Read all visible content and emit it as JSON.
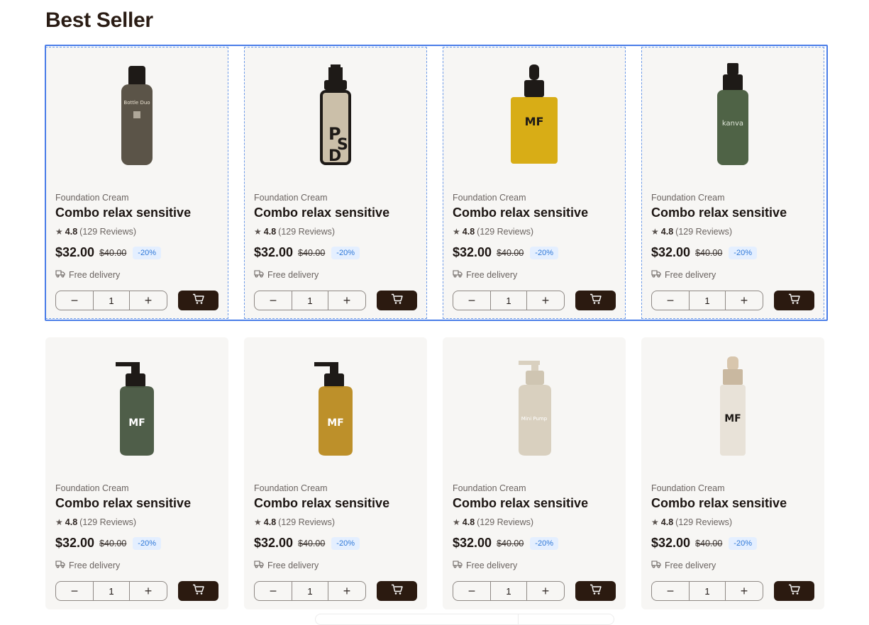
{
  "section": {
    "title": "Best Seller"
  },
  "products": [
    {
      "category": "Foundation Cream",
      "name": "Combo relax sensitive",
      "rating": "4.8",
      "reviews": "(129 Reviews)",
      "price": "$32.00",
      "old_price": "$40.00",
      "discount": "-20%",
      "delivery": "Free delivery",
      "quantity": "1",
      "image": {
        "shape": "bottle-tall",
        "color": "#5b5448",
        "label": "Bottle Duo"
      }
    },
    {
      "category": "Foundation Cream",
      "name": "Combo relax sensitive",
      "rating": "4.8",
      "reviews": "(129 Reviews)",
      "price": "$32.00",
      "old_price": "$40.00",
      "discount": "-20%",
      "delivery": "Free delivery",
      "quantity": "1",
      "image": {
        "shape": "pump-bottle",
        "color": "#cbbfa9",
        "label": "PSD"
      }
    },
    {
      "category": "Foundation Cream",
      "name": "Combo relax sensitive",
      "rating": "4.8",
      "reviews": "(129 Reviews)",
      "price": "$32.00",
      "old_price": "$40.00",
      "discount": "-20%",
      "delivery": "Free delivery",
      "quantity": "1",
      "image": {
        "shape": "dropper-square",
        "color": "#d8ad16",
        "label": "MF"
      }
    },
    {
      "category": "Foundation Cream",
      "name": "Combo relax sensitive",
      "rating": "4.8",
      "reviews": "(129 Reviews)",
      "price": "$32.00",
      "old_price": "$40.00",
      "discount": "-20%",
      "delivery": "Free delivery",
      "quantity": "1",
      "image": {
        "shape": "spray-bottle",
        "color": "#4f6346",
        "label": "kanva"
      }
    },
    {
      "category": "Foundation Cream",
      "name": "Combo relax sensitive",
      "rating": "4.8",
      "reviews": "(129 Reviews)",
      "price": "$32.00",
      "old_price": "$40.00",
      "discount": "-20%",
      "delivery": "Free delivery",
      "quantity": "1",
      "image": {
        "shape": "pump-round",
        "color": "#46553f",
        "label": "MF"
      }
    },
    {
      "category": "Foundation Cream",
      "name": "Combo relax sensitive",
      "rating": "4.8",
      "reviews": "(129 Reviews)",
      "price": "$32.00",
      "old_price": "$40.00",
      "discount": "-20%",
      "delivery": "Free delivery",
      "quantity": "1",
      "image": {
        "shape": "pump-round",
        "color": "#b98a1f",
        "label": "MF"
      }
    },
    {
      "category": "Foundation Cream",
      "name": "Combo relax sensitive",
      "rating": "4.8",
      "reviews": "(129 Reviews)",
      "price": "$32.00",
      "old_price": "$40.00",
      "discount": "-20%",
      "delivery": "Free delivery",
      "quantity": "1",
      "image": {
        "shape": "pump-soft",
        "color": "#d9d0bf",
        "label": "Mini Pump"
      }
    },
    {
      "category": "Foundation Cream",
      "name": "Combo relax sensitive",
      "rating": "4.8",
      "reviews": "(129 Reviews)",
      "price": "$32.00",
      "old_price": "$40.00",
      "discount": "-20%",
      "delivery": "Free delivery",
      "quantity": "1",
      "image": {
        "shape": "airless-tube",
        "color": "#e8e2d8",
        "label": "MF"
      }
    }
  ],
  "icons": {
    "star": "star-icon",
    "delivery": "truck-icon",
    "cart": "cart-icon",
    "minus": "minus-icon",
    "plus": "plus-icon"
  },
  "colors": {
    "cart_button": "#2b1a10",
    "discount_text": "#2f78d8",
    "discount_bg": "#e4efff",
    "card_bg": "#f7f6f4",
    "selection": "#4a7de8"
  }
}
